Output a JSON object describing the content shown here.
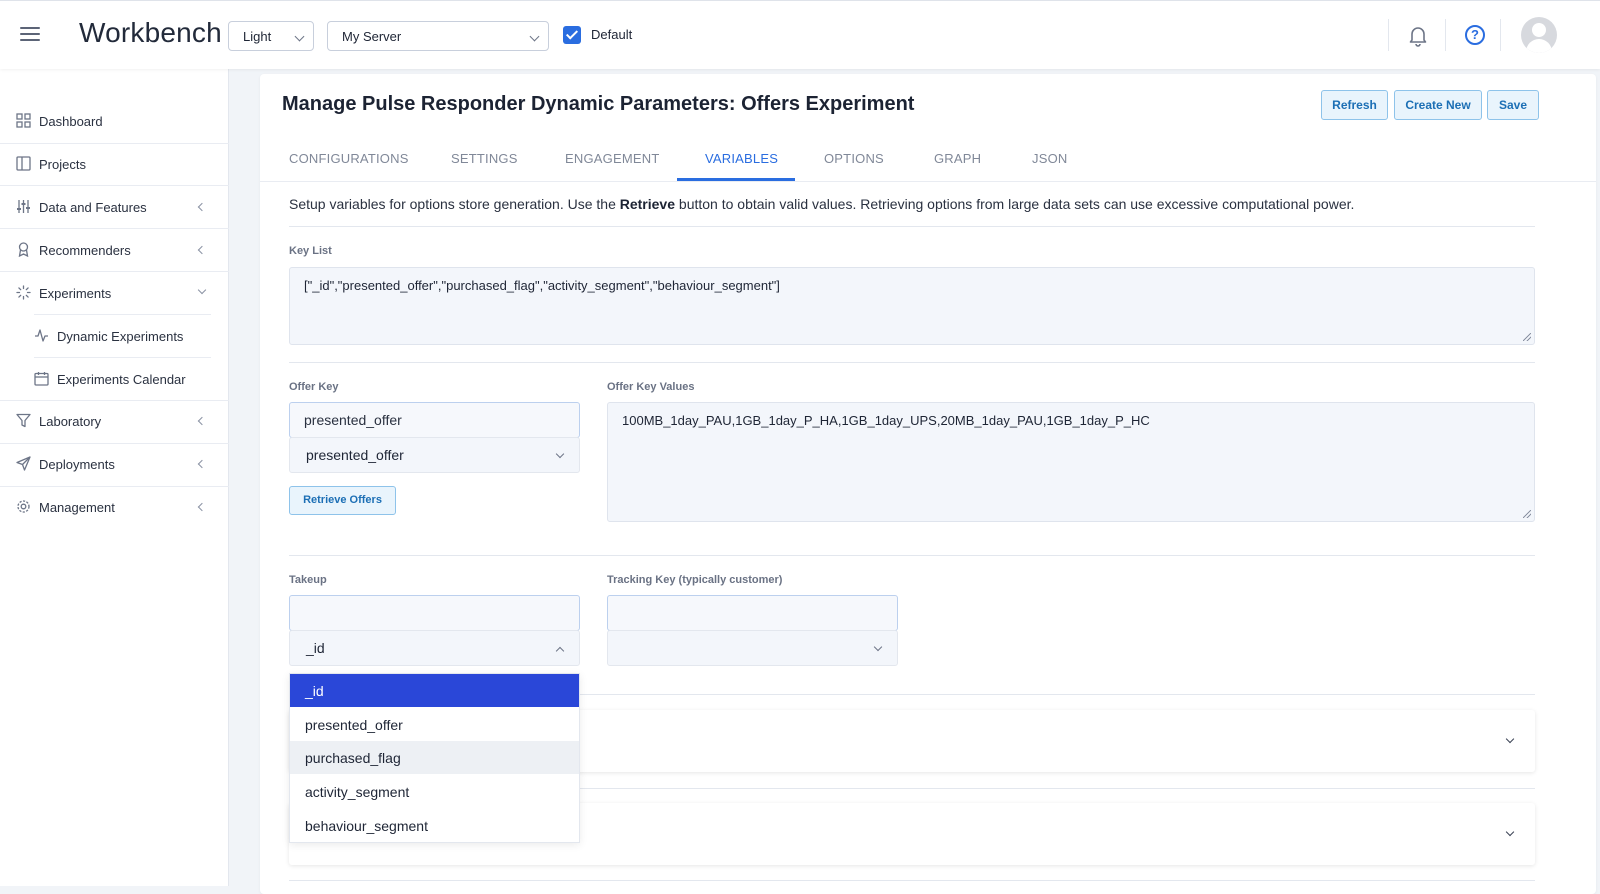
{
  "header": {
    "app_title": "Workbench",
    "theme_select": "Light",
    "server_select": "My Server",
    "default_checkbox_label": "Default",
    "default_checked": true,
    "accent_color": "#2a6de0"
  },
  "sidebar": {
    "items": [
      {
        "label": "Dashboard",
        "icon": "dashboard-icon"
      },
      {
        "label": "Projects",
        "icon": "projects-icon"
      },
      {
        "label": "Data and Features",
        "icon": "sliders-icon"
      },
      {
        "label": "Recommenders",
        "icon": "award-icon"
      },
      {
        "label": "Experiments",
        "icon": "loader-icon"
      },
      {
        "label": "Dynamic Experiments",
        "icon": "activity-icon"
      },
      {
        "label": "Experiments Calendar",
        "icon": "calendar-icon"
      },
      {
        "label": "Laboratory",
        "icon": "filter-icon"
      },
      {
        "label": "Deployments",
        "icon": "send-icon"
      },
      {
        "label": "Management",
        "icon": "gear-icon"
      }
    ]
  },
  "page": {
    "title": "Manage Pulse Responder Dynamic Parameters: Offers Experiment",
    "buttons": {
      "refresh": "Refresh",
      "create_new": "Create New",
      "save": "Save"
    },
    "tabs": [
      "CONFIGURATIONS",
      "SETTINGS",
      "ENGAGEMENT",
      "VARIABLES",
      "OPTIONS",
      "GRAPH",
      "JSON"
    ],
    "active_tab": "VARIABLES",
    "intro": {
      "before": "Setup variables for options store generation. Use the ",
      "bold": "Retrieve",
      "after": " button to obtain valid values. Retrieving options from large data sets can use excessive computational power."
    }
  },
  "form": {
    "key_list_label": "Key List",
    "key_list_value": "[\"_id\",\"presented_offer\",\"purchased_flag\",\"activity_segment\",\"behaviour_segment\"]",
    "offer_key_label": "Offer Key",
    "offer_key_input": "presented_offer",
    "offer_key_select": "presented_offer",
    "retrieve_offers_button": "Retrieve Offers",
    "offer_key_values_label": "Offer Key Values",
    "offer_key_values_value": "100MB_1day_PAU,1GB_1day_P_HA,1GB_1day_UPS,20MB_1day_PAU,1GB_1day_P_HC",
    "takeup_label": "Takeup",
    "takeup_input": "",
    "takeup_select": "_id",
    "tracking_key_label": "Tracking Key (typically customer)",
    "tracking_key_input": "",
    "tracking_key_select": ""
  },
  "takeup_dropdown": {
    "options": [
      "_id",
      "presented_offer",
      "purchased_flag",
      "activity_segment",
      "behaviour_segment"
    ],
    "selected": "_id",
    "hovered": "purchased_flag"
  }
}
